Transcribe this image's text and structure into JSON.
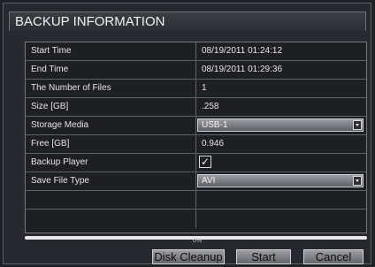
{
  "dialog": {
    "title": "BACKUP INFORMATION"
  },
  "fields": {
    "start_time": {
      "label": "Start Time",
      "value": "08/19/2011 01:24:12"
    },
    "end_time": {
      "label": "End Time",
      "value": "08/19/2011 01:29:36"
    },
    "num_files": {
      "label": "The Number of Files",
      "value": "1"
    },
    "size": {
      "label": "Size [GB]",
      "value": ".258"
    },
    "storage_media": {
      "label": "Storage Media",
      "value": "USB-1"
    },
    "free": {
      "label": "Free [GB]",
      "value": "0.946"
    },
    "backup_player": {
      "label": "Backup Player",
      "checked": true,
      "check_glyph": "✓"
    },
    "save_file_type": {
      "label": "Save File Type",
      "value": "AVI"
    }
  },
  "progress": {
    "percent_text": "0%",
    "value": 0
  },
  "buttons": {
    "disk_cleanup": "Disk Cleanup",
    "start": "Start",
    "cancel": "Cancel"
  },
  "icons": {
    "dropdown": "chevron-down-icon",
    "check": "check-icon"
  }
}
